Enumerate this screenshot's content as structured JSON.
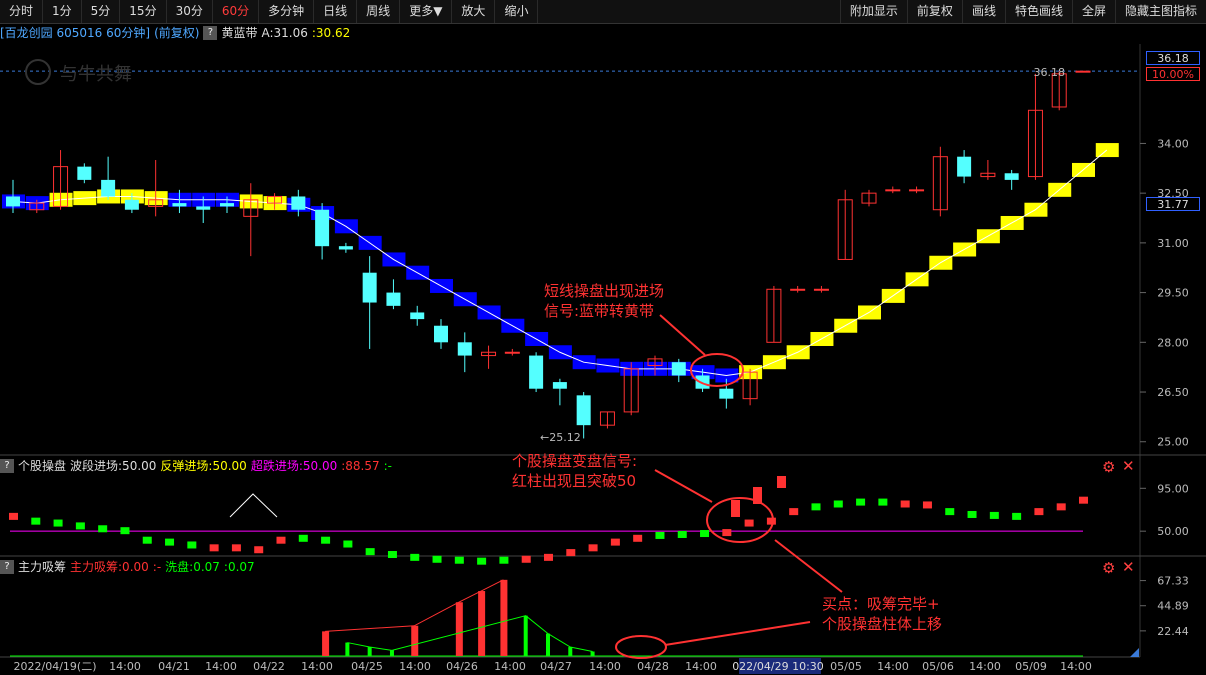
{
  "toolbar": {
    "left": [
      "分时",
      "1分",
      "5分",
      "15分",
      "30分",
      "60分",
      "多分钟",
      "日线",
      "周线",
      "更多▼",
      "放大",
      "缩小"
    ],
    "active": "60分",
    "right": [
      "附加显示",
      "前复权",
      "画线",
      "特色画线",
      "全屏",
      "隐藏主图指标"
    ]
  },
  "header": {
    "stock": "[百龙创园 605016 60分钟]",
    "adjust": "(前复权)",
    "help": "?",
    "indicator": "黄蓝带",
    "a_label": "A:31.06",
    "value2": ":30.62"
  },
  "price_tags": {
    "top": "36.18",
    "pct": "10.00%",
    "current": "31.77"
  },
  "watermark": "与牛共舞",
  "panel2": {
    "name": "个股操盘",
    "v1": "波段进场:50.00",
    "v2": "反弹进场:50.00",
    "v3": "超跌进场:50.00",
    "v4": ":88.57",
    "v5": ":-"
  },
  "panel3": {
    "name": "主力吸筹",
    "v1": "主力吸筹:0.00",
    "v2": ":-",
    "v3": "洗盘:0.07",
    "v4": ":0.07"
  },
  "annotations": {
    "a1_line1": "短线操盘出现进场",
    "a1_line2": "信号:蓝带转黄带",
    "a2_line1": "个股操盘变盘信号:",
    "a2_line2": "红柱出现且突破50",
    "a3_line1": "买点：吸筹完毕+",
    "a3_line2": "个股操盘柱体上移"
  },
  "colors": {
    "up": "#ff3232",
    "down": "#54ffff",
    "blue_band": "#0000ff",
    "yellow_band": "#ffff00",
    "green": "#00ff00",
    "magenta": "#ff00ff",
    "label_red": "#ff3232"
  },
  "chart_data": [
    {
      "type": "candlestick",
      "title": "黄蓝带",
      "ylim": [
        24.6,
        37.0
      ],
      "y_ticks": [
        "36.18",
        "34.00",
        "32.50",
        "31.00",
        "29.50",
        "28.00",
        "26.50",
        "25.00"
      ],
      "x_labels": [
        "2022/04/19(二)",
        "14:00",
        "04/21",
        "14:00",
        "04/22",
        "14:00",
        "04/25",
        "14:00",
        "04/26",
        "14:00",
        "04/27",
        "14:00",
        "04/28",
        "14:00",
        "022/04/29 10:30",
        "05/05",
        "14:00",
        "05/06",
        "14:00",
        "05/09",
        "14:00"
      ],
      "high_label": "36.18",
      "low_label": "25.12",
      "candles": [
        {
          "o": 32.4,
          "h": 32.9,
          "l": 31.9,
          "c": 32.1
        },
        {
          "o": 32.0,
          "h": 32.3,
          "l": 31.9,
          "c": 32.2
        },
        {
          "o": 32.1,
          "h": 33.8,
          "l": 32.0,
          "c": 33.3
        },
        {
          "o": 33.3,
          "h": 33.4,
          "l": 32.8,
          "c": 32.9
        },
        {
          "o": 32.9,
          "h": 33.6,
          "l": 32.3,
          "c": 32.4
        },
        {
          "o": 32.3,
          "h": 32.5,
          "l": 31.9,
          "c": 32.0
        },
        {
          "o": 32.1,
          "h": 33.5,
          "l": 31.8,
          "c": 32.3
        },
        {
          "o": 32.2,
          "h": 32.6,
          "l": 31.9,
          "c": 32.1
        },
        {
          "o": 32.1,
          "h": 32.4,
          "l": 31.6,
          "c": 32.0
        },
        {
          "o": 32.2,
          "h": 32.4,
          "l": 31.9,
          "c": 32.1
        },
        {
          "o": 31.8,
          "h": 32.8,
          "l": 30.6,
          "c": 32.3
        },
        {
          "o": 32.2,
          "h": 32.5,
          "l": 32.0,
          "c": 32.4
        },
        {
          "o": 32.4,
          "h": 32.6,
          "l": 31.8,
          "c": 32.0
        },
        {
          "o": 32.0,
          "h": 32.2,
          "l": 30.5,
          "c": 30.9
        },
        {
          "o": 30.9,
          "h": 31.0,
          "l": 30.7,
          "c": 30.8
        },
        {
          "o": 30.1,
          "h": 30.6,
          "l": 27.8,
          "c": 29.2
        },
        {
          "o": 29.5,
          "h": 29.9,
          "l": 29.0,
          "c": 29.1
        },
        {
          "o": 28.9,
          "h": 29.1,
          "l": 28.5,
          "c": 28.7
        },
        {
          "o": 28.5,
          "h": 28.7,
          "l": 27.8,
          "c": 28.0
        },
        {
          "o": 28.0,
          "h": 28.3,
          "l": 27.1,
          "c": 27.6
        },
        {
          "o": 27.6,
          "h": 27.9,
          "l": 27.2,
          "c": 27.7
        },
        {
          "o": 27.7,
          "h": 27.8,
          "l": 27.6,
          "c": 27.7
        },
        {
          "o": 27.6,
          "h": 27.7,
          "l": 26.5,
          "c": 26.6
        },
        {
          "o": 26.8,
          "h": 26.9,
          "l": 26.1,
          "c": 26.6
        },
        {
          "o": 26.4,
          "h": 26.5,
          "l": 25.1,
          "c": 25.5
        },
        {
          "o": 25.5,
          "h": 25.9,
          "l": 25.4,
          "c": 25.9
        },
        {
          "o": 25.9,
          "h": 27.4,
          "l": 25.8,
          "c": 27.2
        },
        {
          "o": 27.3,
          "h": 27.6,
          "l": 27.0,
          "c": 27.5
        },
        {
          "o": 27.4,
          "h": 27.5,
          "l": 26.8,
          "c": 27.0
        },
        {
          "o": 27.0,
          "h": 27.2,
          "l": 26.5,
          "c": 26.6
        },
        {
          "o": 26.6,
          "h": 26.9,
          "l": 26.0,
          "c": 26.3
        },
        {
          "o": 26.3,
          "h": 27.2,
          "l": 26.1,
          "c": 27.1
        },
        {
          "o": 28.0,
          "h": 29.7,
          "l": 28.0,
          "c": 29.6
        },
        {
          "o": 29.6,
          "h": 29.7,
          "l": 29.5,
          "c": 29.6
        },
        {
          "o": 29.6,
          "h": 29.7,
          "l": 29.5,
          "c": 29.6
        },
        {
          "o": 30.5,
          "h": 32.6,
          "l": 30.5,
          "c": 32.3
        },
        {
          "o": 32.2,
          "h": 32.6,
          "l": 32.1,
          "c": 32.5
        },
        {
          "o": 32.6,
          "h": 32.7,
          "l": 32.5,
          "c": 32.6
        },
        {
          "o": 32.6,
          "h": 32.7,
          "l": 32.5,
          "c": 32.6
        },
        {
          "o": 32.0,
          "h": 33.9,
          "l": 31.8,
          "c": 33.6
        },
        {
          "o": 33.6,
          "h": 33.8,
          "l": 32.8,
          "c": 33.0
        },
        {
          "o": 33.0,
          "h": 33.5,
          "l": 32.9,
          "c": 33.1
        },
        {
          "o": 33.1,
          "h": 33.2,
          "l": 32.6,
          "c": 32.9
        },
        {
          "o": 33.0,
          "h": 36.1,
          "l": 32.9,
          "c": 35.0
        },
        {
          "o": 35.1,
          "h": 36.18,
          "l": 35.0,
          "c": 36.1
        },
        {
          "o": 36.18,
          "h": 36.18,
          "l": 36.18,
          "c": 36.18
        }
      ],
      "band": [
        32.25,
        32.2,
        32.3,
        32.35,
        32.4,
        32.4,
        32.35,
        32.3,
        32.3,
        32.3,
        32.25,
        32.2,
        32.15,
        31.9,
        31.5,
        31.0,
        30.5,
        30.1,
        29.7,
        29.3,
        28.9,
        28.5,
        28.1,
        27.7,
        27.4,
        27.3,
        27.2,
        27.2,
        27.2,
        27.1,
        27.0,
        27.1,
        27.4,
        27.7,
        28.1,
        28.5,
        28.9,
        29.4,
        29.9,
        30.4,
        30.8,
        31.2,
        31.6,
        32.0,
        32.6,
        33.2,
        33.8
      ],
      "band_color": [
        "b",
        "b",
        "y",
        "y",
        "y",
        "y",
        "y",
        "b",
        "b",
        "b",
        "y",
        "y",
        "b",
        "b",
        "b",
        "b",
        "b",
        "b",
        "b",
        "b",
        "b",
        "b",
        "b",
        "b",
        "b",
        "b",
        "b",
        "b",
        "b",
        "b",
        "b",
        "y",
        "y",
        "y",
        "y",
        "y",
        "y",
        "y",
        "y",
        "y",
        "y",
        "y",
        "y",
        "y",
        "y",
        "y",
        "y"
      ]
    },
    {
      "type": "bar",
      "title": "个股操盘",
      "ylim": [
        25,
        110
      ],
      "y_ticks": [
        "95.00",
        "50.00"
      ],
      "ref_line": 50,
      "values": [
        65,
        60,
        58,
        55,
        52,
        50,
        40,
        38,
        35,
        32,
        32,
        30,
        40,
        42,
        40,
        36,
        28,
        25,
        22,
        20,
        19,
        18,
        19,
        20,
        22,
        27,
        32,
        38,
        42,
        45,
        46,
        47,
        48,
        58,
        60,
        70,
        75,
        78,
        80,
        80,
        78,
        77,
        70,
        67,
        66,
        65,
        70,
        75,
        82
      ],
      "dir": [
        "u",
        "d",
        "d",
        "d",
        "d",
        "d",
        "d",
        "d",
        "d",
        "u",
        "u",
        "u",
        "u",
        "d",
        "d",
        "d",
        "d",
        "d",
        "d",
        "d",
        "d",
        "d",
        "d",
        "u",
        "u",
        "u",
        "u",
        "u",
        "u",
        "d",
        "d",
        "d",
        "u",
        "u",
        "u",
        "u",
        "d",
        "d",
        "d",
        "d",
        "u",
        "u",
        "d",
        "d",
        "d",
        "d",
        "u",
        "u",
        "u"
      ]
    },
    {
      "type": "bar",
      "title": "主力吸筹",
      "ylim": [
        0,
        75
      ],
      "y_ticks": [
        "67.33",
        "44.89",
        "22.44"
      ],
      "red_values": [
        0,
        0,
        0,
        0,
        0,
        0,
        0,
        0,
        0,
        0,
        0,
        0,
        0,
        0,
        0,
        0,
        0,
        0,
        0,
        0,
        0,
        0,
        0,
        0,
        0,
        0,
        0,
        0,
        0,
        0,
        0,
        0,
        0,
        0,
        0,
        0,
        0,
        0,
        0,
        0,
        0,
        0,
        0,
        0,
        0,
        0,
        0,
        0,
        0
      ],
      "spike_idx": [
        14,
        18,
        20,
        21,
        22
      ],
      "spike_vals": [
        22,
        27,
        48,
        58,
        68
      ],
      "green_idx": [
        15,
        16,
        17,
        23,
        24,
        25,
        26
      ],
      "green_vals": [
        12,
        8,
        5,
        36,
        20,
        8,
        4
      ],
      "label": "0.07"
    }
  ]
}
